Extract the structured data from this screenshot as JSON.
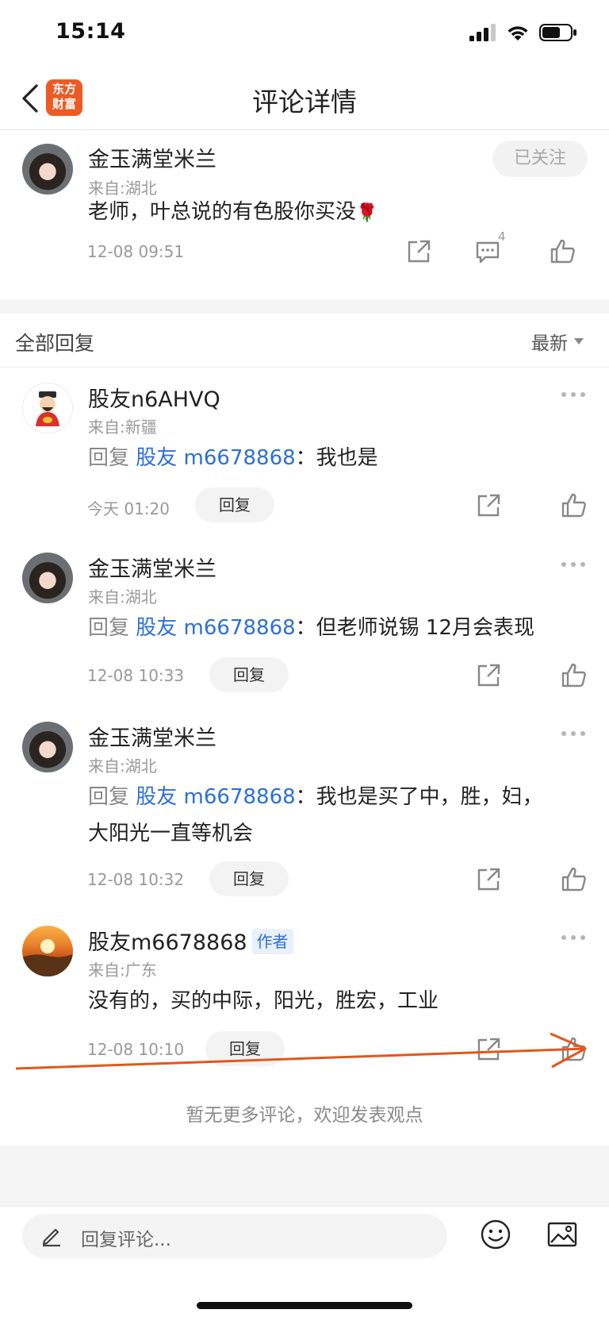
{
  "status_bar": {
    "time": "15:14"
  },
  "nav": {
    "title": "评论详情",
    "logo_line1": "东方",
    "logo_line2": "财富"
  },
  "main_comment": {
    "author": "金玉满堂米兰",
    "location": "来自:湖北",
    "text": "老师，叶总说的有色股你买没",
    "emoji": "🌹",
    "time": "12-08 09:51",
    "follow_label": "已关注",
    "comment_count": "4"
  },
  "replies_header": {
    "title": "全部回复",
    "sort_label": "最新"
  },
  "replies": [
    {
      "author": "股友n6AHVQ",
      "location": "来自:新疆",
      "reply_prefix": "回复 ",
      "mention": "股友 m6678868",
      "text_line1": "：我也是",
      "text_line2": "",
      "time": "今天 01:20",
      "reply_label": "回复",
      "author_tag": ""
    },
    {
      "author": "金玉满堂米兰",
      "location": "来自:湖北",
      "reply_prefix": "回复 ",
      "mention": "股友 m6678868",
      "text_line1": "：但老师说锡 12月会表现",
      "text_line2": "",
      "time": "12-08 10:33",
      "reply_label": "回复",
      "author_tag": ""
    },
    {
      "author": "金玉满堂米兰",
      "location": "来自:湖北",
      "reply_prefix": "回复 ",
      "mention": "股友 m6678868",
      "text_line1": "：我也是买了中，胜，妇，",
      "text_line2": "大阳光一直等机会",
      "time": "12-08 10:32",
      "reply_label": "回复",
      "author_tag": ""
    },
    {
      "author": "股友m6678868",
      "location": "来自:广东",
      "reply_prefix": "",
      "mention": "",
      "text_line1": "没有的，买的中际，阳光，胜宏，工业",
      "text_line2": "",
      "time": "12-08 10:10",
      "reply_label": "回复",
      "author_tag": "作者"
    }
  ],
  "footer": {
    "no_more": "暂无更多评论，欢迎发表观点"
  },
  "input_bar": {
    "placeholder": "回复评论..."
  },
  "colors": {
    "accent_orange": "#ee5a24",
    "mention_blue": "#2d6fd6",
    "annotation_arrow": "#e2571c"
  },
  "icons": [
    "back-icon",
    "signal-icon",
    "wifi-icon",
    "battery-icon",
    "share-icon",
    "comment-icon",
    "like-icon",
    "more-icon",
    "sort-arrow-icon",
    "pen-icon",
    "emoji-icon",
    "image-icon"
  ]
}
